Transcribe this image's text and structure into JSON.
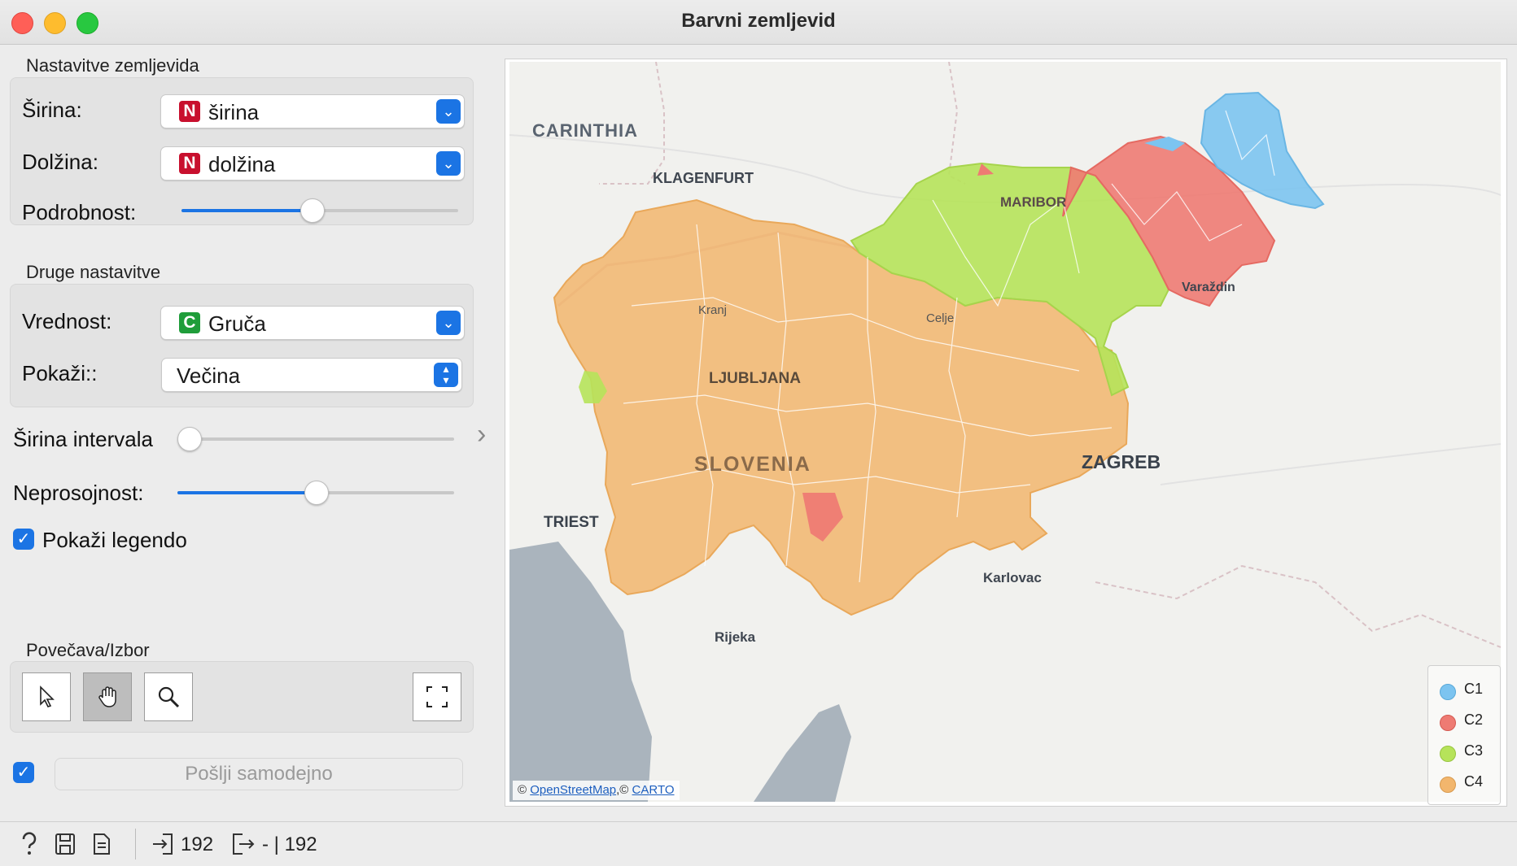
{
  "window": {
    "title": "Barvni zemljevid"
  },
  "map_settings": {
    "section_title": "Nastavitve zemljevida",
    "latitude_label": "Širina:",
    "latitude_badge": "N",
    "latitude_value": "širina",
    "longitude_label": "Dolžina:",
    "longitude_badge": "N",
    "longitude_value": "dolžina",
    "detail_label": "Podrobnost:",
    "detail_level": 0.5
  },
  "other_settings": {
    "section_title": "Druge nastavitve",
    "value_label": "Vrednost:",
    "value_badge": "C",
    "value_value": "Gruča",
    "show_label": "Pokaži::",
    "show_value": "Večina"
  },
  "bin_width": {
    "label": "Širina intervala",
    "level": 0.0
  },
  "opacity": {
    "label": "Neprosojnost:",
    "level": 0.5
  },
  "show_legend": {
    "label": "Pokaži legendo",
    "checked": true
  },
  "zoom_select": {
    "section_title": "Povečava/Izbor",
    "tools": [
      "pointer-icon",
      "hand-icon",
      "zoom-icon",
      "fit-icon"
    ]
  },
  "send": {
    "label": "Pošlji samodejno",
    "checked": true
  },
  "map": {
    "place_labels": [
      "CARINTHIA",
      "KLAGENFURT",
      "MARIBOR",
      "Varaždin",
      "Kranj",
      "Celje",
      "LJUBLJANA",
      "SLOVENIA",
      "ZAGREB",
      "TRIEST",
      "Karlovac",
      "Rijeka"
    ],
    "attribution": {
      "prefix": "©",
      "osm": "OpenStreetMap",
      "sep": ",©",
      "carto": "CARTO"
    }
  },
  "legend": {
    "items": [
      {
        "label": "C1",
        "color": "#7cc4f0"
      },
      {
        "label": "C2",
        "color": "#ee7b73"
      },
      {
        "label": "C3",
        "color": "#b6e35a"
      },
      {
        "label": "C4",
        "color": "#f2b66d"
      }
    ]
  },
  "status": {
    "input_count": "192",
    "output_count": "- | 192"
  }
}
